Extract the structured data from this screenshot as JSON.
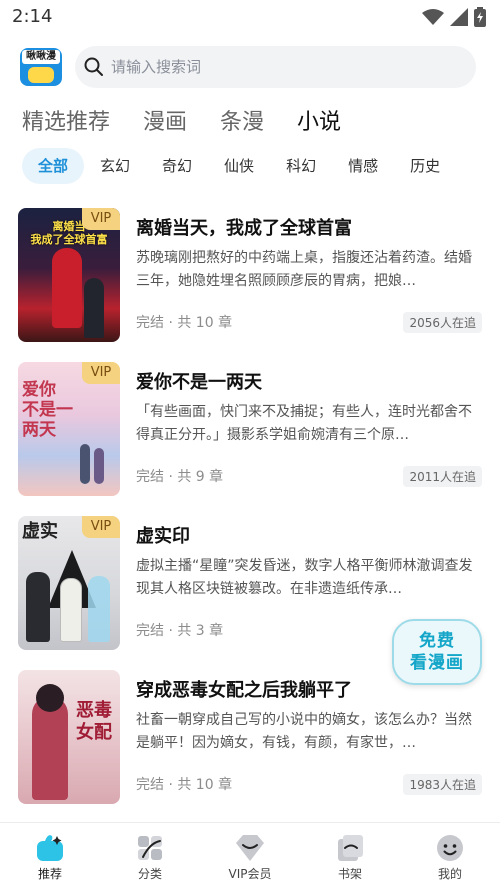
{
  "status": {
    "time": "2:14"
  },
  "header": {
    "logo_text": "啾啾漫",
    "search_placeholder": "请输入搜索词"
  },
  "main_tabs": [
    {
      "label": "精选推荐",
      "active": false
    },
    {
      "label": "漫画",
      "active": false
    },
    {
      "label": "条漫",
      "active": false
    },
    {
      "label": "小说",
      "active": true
    }
  ],
  "sub_tabs": [
    {
      "label": "全部",
      "active": true
    },
    {
      "label": "玄幻"
    },
    {
      "label": "奇幻"
    },
    {
      "label": "仙侠"
    },
    {
      "label": "科幻"
    },
    {
      "label": "情感"
    },
    {
      "label": "历史"
    }
  ],
  "books": [
    {
      "title": "离婚当天，我成了全球首富",
      "desc": "苏晚璃刚把熬好的中药端上桌，指腹还沾着药渣。结婚三年，她隐姓埋名照顾顾彦辰的胃病，把娘…",
      "meta": "完结 · 共 10 章",
      "readers": "2056人在追",
      "vip": "VIP",
      "cover_text": "离婚当\n我成了全球首富"
    },
    {
      "title": "爱你不是一两天",
      "desc": "「有些画面，快门来不及捕捉；有些人，连时光都舍不得真正分开。」摄影系学姐俞婉清有三个原…",
      "meta": "完结 · 共 9 章",
      "readers": "2011人在追",
      "vip": "VIP",
      "cover_text": "爱你\n不是一\n两天"
    },
    {
      "title": "虚实印",
      "desc": "虚拟主播“星瞳”突发昏迷，数字人格平衡师林澈调查发现其人格区块链被篡改。在非遗造纸传承…",
      "meta": "完结 · 共 3 章",
      "readers": "",
      "vip": "VIP",
      "cover_text": "虚实"
    },
    {
      "title": "穿成恶毒女配之后我躺平了",
      "desc": "社畜一朝穿成自己写的小说中的嫡女，该怎么办？当然是躺平！因为嫡女，有钱，有颜，有家世，…",
      "meta": "完结 · 共 10 章",
      "readers": "1983人在追",
      "vip": "",
      "cover_text": "恶毒\n女配"
    }
  ],
  "promo": {
    "line1": "免费",
    "line2": "看漫画"
  },
  "bottom_nav": [
    {
      "label": "推荐",
      "icon": "recommend-icon",
      "active": true
    },
    {
      "label": "分类",
      "icon": "category-icon"
    },
    {
      "label": "VIP会员",
      "icon": "vip-icon"
    },
    {
      "label": "书架",
      "icon": "bookshelf-icon"
    },
    {
      "label": "我的",
      "icon": "profile-icon"
    }
  ],
  "colors": {
    "accent": "#1e90d8",
    "tab_highlight": "#bfe9fa",
    "vip_bg": "#f5d27f",
    "promo_text": "#14a6c9"
  }
}
